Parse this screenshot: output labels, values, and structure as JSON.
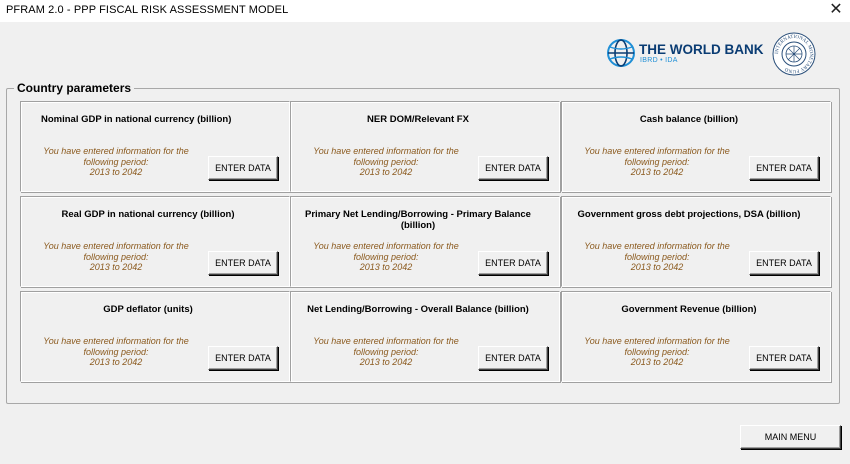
{
  "window": {
    "title": "PFRAM 2.0 - PPP FISCAL RISK ASSESSMENT MODEL",
    "close_glyph": "✕"
  },
  "logos": {
    "world_bank": {
      "name": "THE WORLD BANK",
      "sub": "IBRD • IDA",
      "color": "#0a3c73",
      "accent": "#1f8fd6"
    },
    "imf": {
      "ring_text": "INTERNATIONAL MONETARY FUND",
      "color": "#2a4f7a"
    }
  },
  "group": {
    "title": "Country parameters"
  },
  "cards": [
    {
      "title": "Nominal GDP in national currency (billion)",
      "info": [
        "You have entered information for the",
        "following period:",
        "2013 to 2042"
      ],
      "button": "ENTER DATA"
    },
    {
      "title": "NER DOM/Relevant FX",
      "info": [
        "You have entered information for the",
        "following period:",
        "2013 to 2042"
      ],
      "button": "ENTER DATA"
    },
    {
      "title": "Cash balance (billion)",
      "info": [
        "You have entered information for the",
        "following period:",
        "2013 to 2042"
      ],
      "button": "ENTER DATA"
    },
    {
      "title": "Real GDP in national currency (billion)",
      "info": [
        "You have entered information for the",
        "following period:",
        "2013 to 2042"
      ],
      "button": "ENTER DATA"
    },
    {
      "title": "Primary Net Lending/Borrowing  - Primary Balance (billion)",
      "info": [
        "You have entered information for the",
        "following period:",
        "2013 to 2042"
      ],
      "button": "ENTER DATA"
    },
    {
      "title": "Government gross debt projections, DSA (billion)",
      "info": [
        "You have entered information for the",
        "following period:",
        "2013 to 2042"
      ],
      "button": "ENTER DATA"
    },
    {
      "title": "GDP deflator (units)",
      "info": [
        "You have entered information for the",
        "following period:",
        "2013 to 2042"
      ],
      "button": "ENTER DATA"
    },
    {
      "title": "Net Lending/Borrowing - Overall Balance (billion)",
      "info": [
        "You have entered information for the",
        "following period:",
        "2013 to 2042"
      ],
      "button": "ENTER DATA"
    },
    {
      "title": "Government Revenue (billion)",
      "info": [
        "You have entered information for the",
        "following period:",
        "2013 to 2042"
      ],
      "button": "ENTER DATA"
    }
  ],
  "footer": {
    "main_menu": "MAIN MENU"
  },
  "colors": {
    "info_text": "#8b5a1e",
    "background": "#f0f0f0"
  }
}
